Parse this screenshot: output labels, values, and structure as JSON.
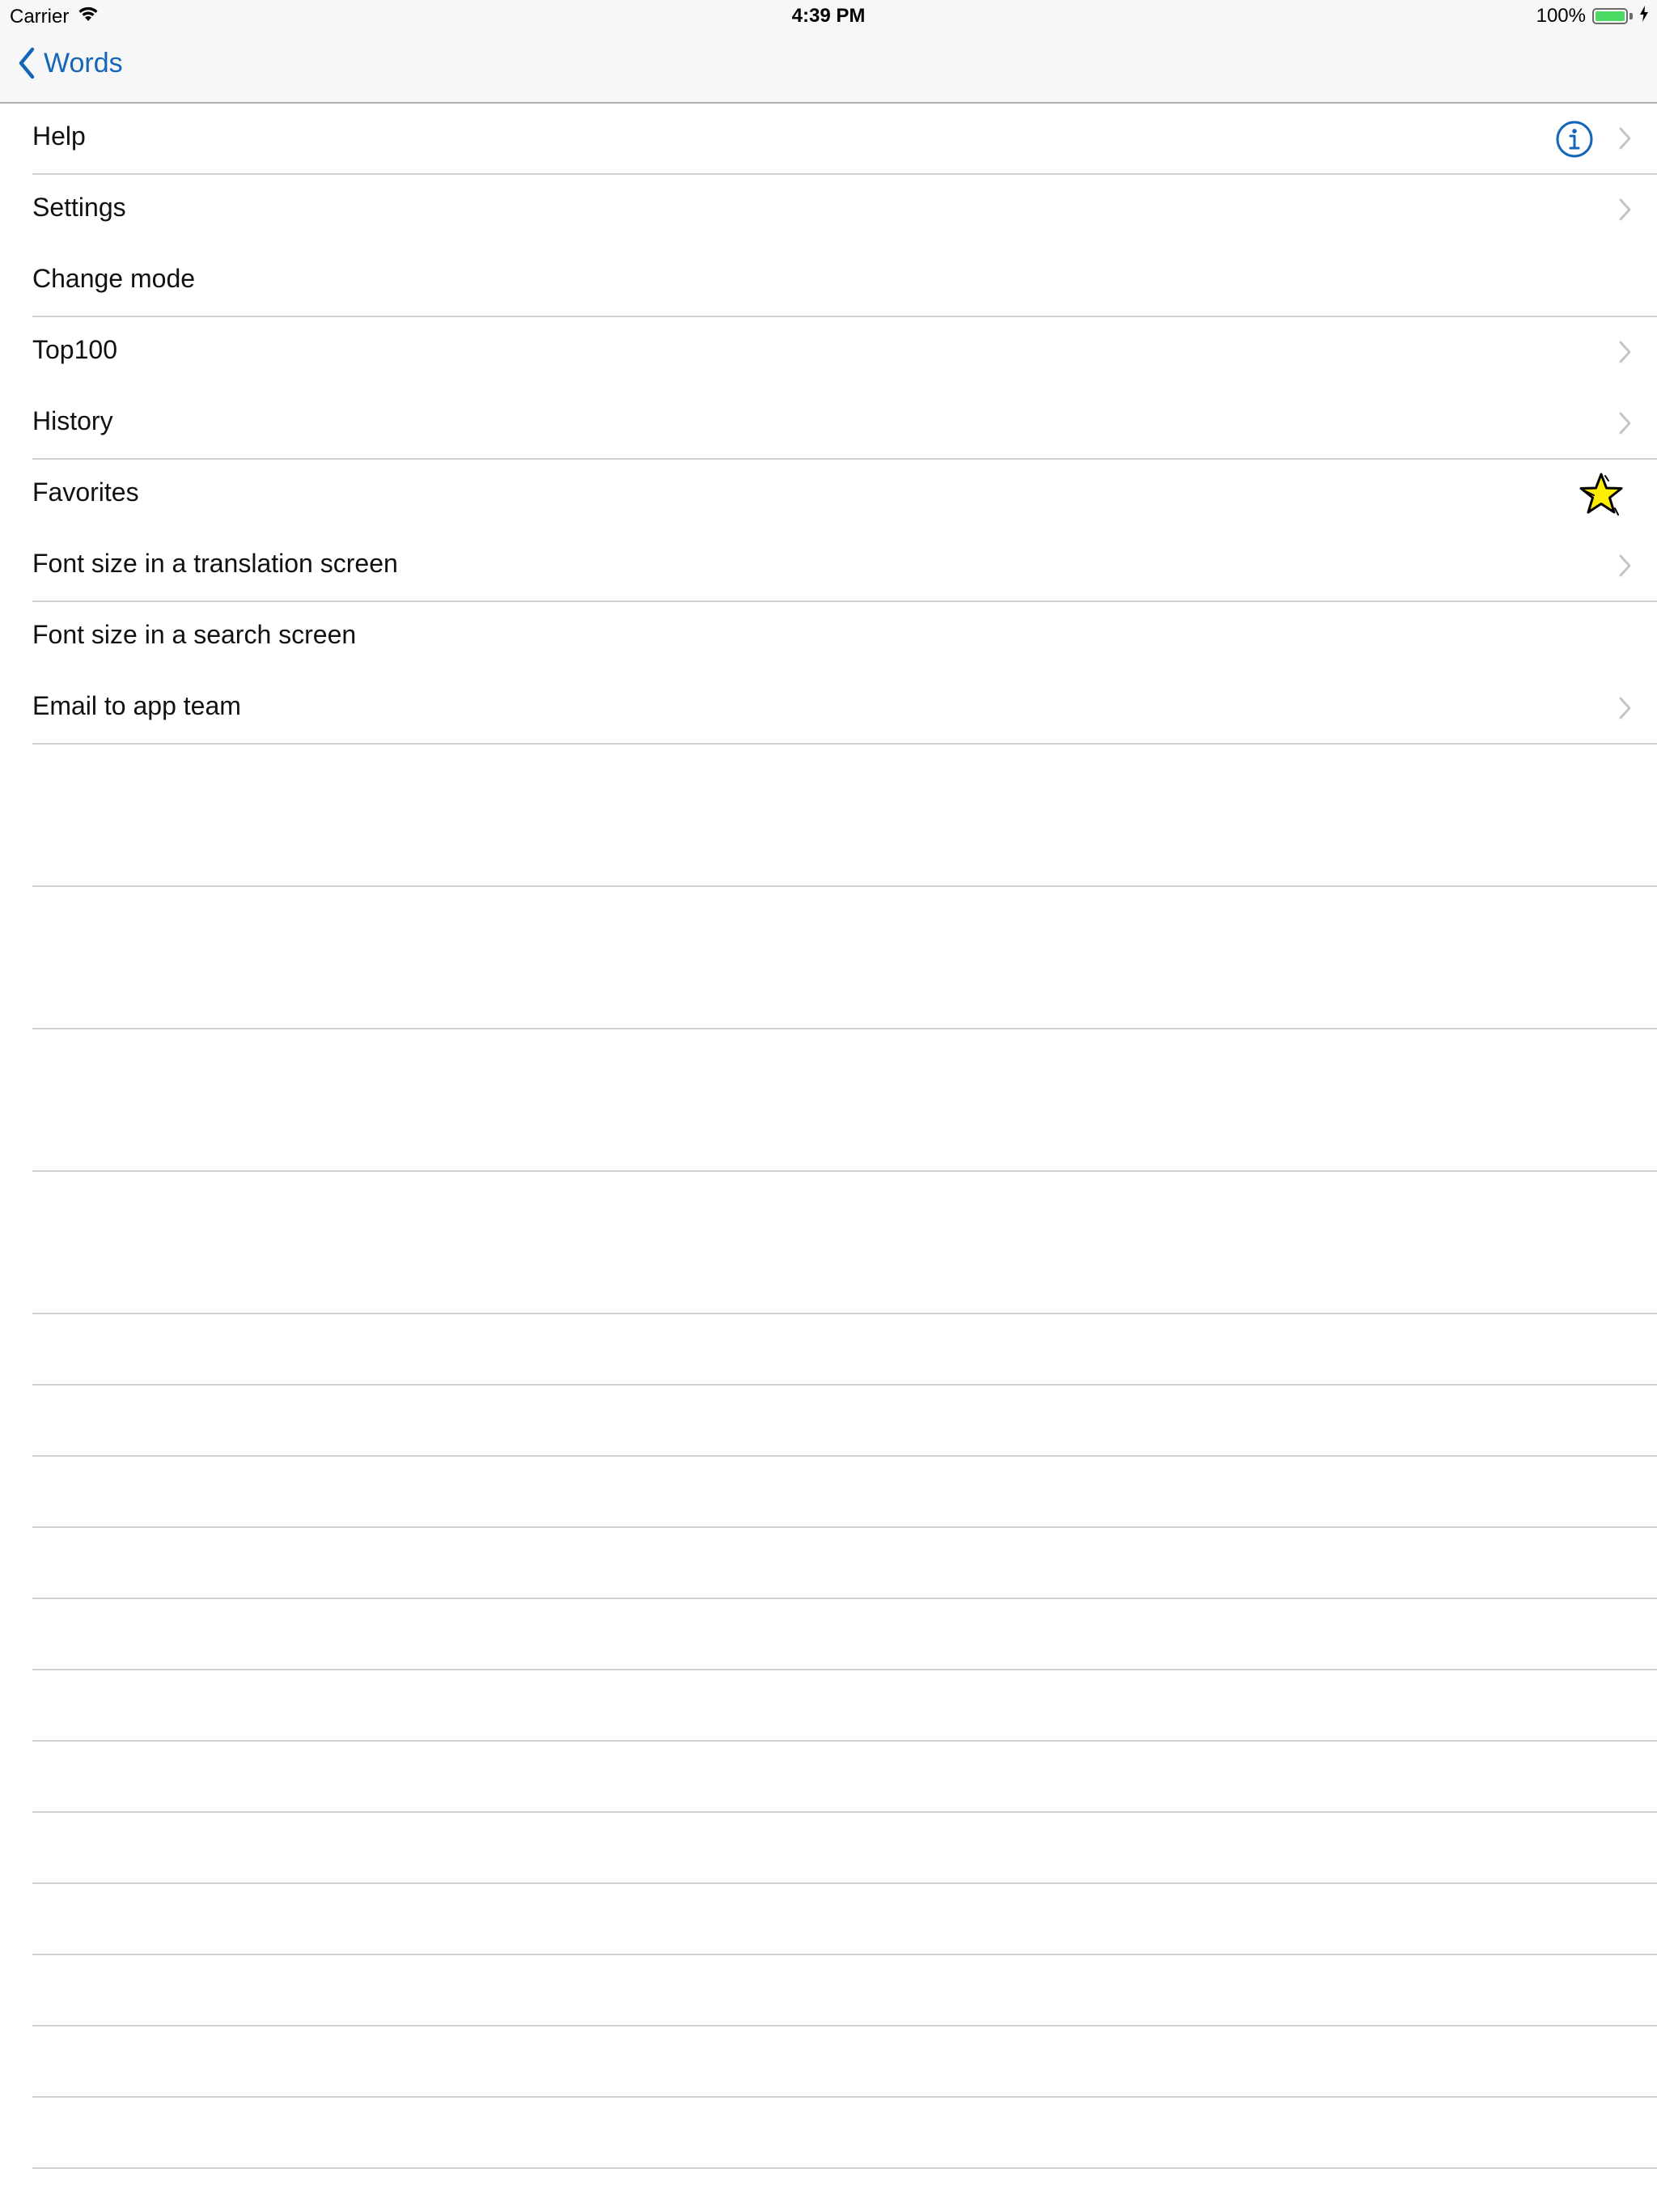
{
  "status_bar": {
    "carrier": "Carrier",
    "time": "4:39 PM",
    "battery_percent": "100%",
    "battery_level": 1.0
  },
  "nav": {
    "back_label": "Words"
  },
  "menu": {
    "items": [
      {
        "label": "Help",
        "accessory": "info-icon+chevron"
      },
      {
        "label": "Settings",
        "accessory": "chevron"
      },
      {
        "label": "Change mode",
        "accessory": "none"
      },
      {
        "label": "Top100",
        "accessory": "chevron"
      },
      {
        "label": "History",
        "accessory": "chevron"
      },
      {
        "label": "Favorites",
        "accessory": "star-icon"
      },
      {
        "label": "Font size in a translation screen",
        "accessory": "chevron"
      },
      {
        "label": "Font size in a search screen",
        "accessory": "none"
      },
      {
        "label": "Email to app team",
        "accessory": "chevron"
      }
    ]
  },
  "colors": {
    "accent": "#1466b8",
    "separator": "#d0d0d0",
    "chevron": "#c4c4c7",
    "star": "#ffee00",
    "battery": "#4cd964"
  }
}
